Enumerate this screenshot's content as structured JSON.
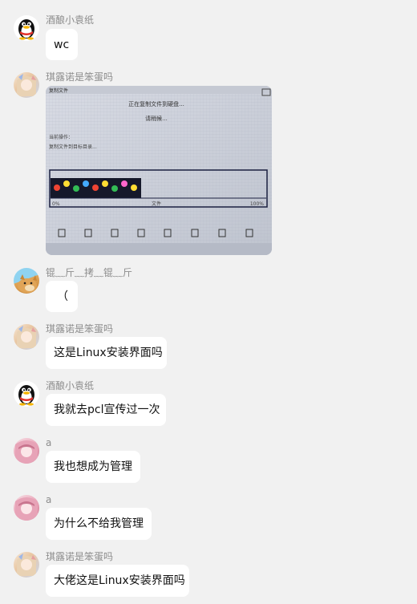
{
  "messages": [
    {
      "sender": "酒酿小袁纸",
      "text": "wc"
    },
    {
      "sender": "琪露诺是笨蛋吗",
      "image": {
        "title": "复制文件",
        "line1": "正在复制文件到硬盘...",
        "line2": "请稍候...",
        "status1": "当前操作：",
        "status2": "复制文件到目标目录...",
        "progress_left": "0%",
        "progress_mid": "文件",
        "progress_right": "100%",
        "progress": 0.42
      }
    },
    {
      "sender": "锟﹏斤﹏拷﹏锟﹏斤",
      "text": "（"
    },
    {
      "sender": "琪露诺是笨蛋吗",
      "text": "这是Linux安装界面吗"
    },
    {
      "sender": "酒酿小袁纸",
      "text": "我就去pcl宣传过一次"
    },
    {
      "sender": "a",
      "text": "我也想成为管理"
    },
    {
      "sender": "a",
      "text": "为什么不给我管理"
    },
    {
      "sender": "琪露诺是笨蛋吗",
      "text": "大佬这是Linux安装界面吗"
    }
  ],
  "colors": {
    "background": "#f1f1f1",
    "bubble": "#ffffff",
    "name_text": "#8c8c8c",
    "accent_red": "#e4312b"
  },
  "icons": [
    "qq-penguin-avatar",
    "anime-avatar",
    "doge-avatar",
    "pink-anime-avatar"
  ]
}
